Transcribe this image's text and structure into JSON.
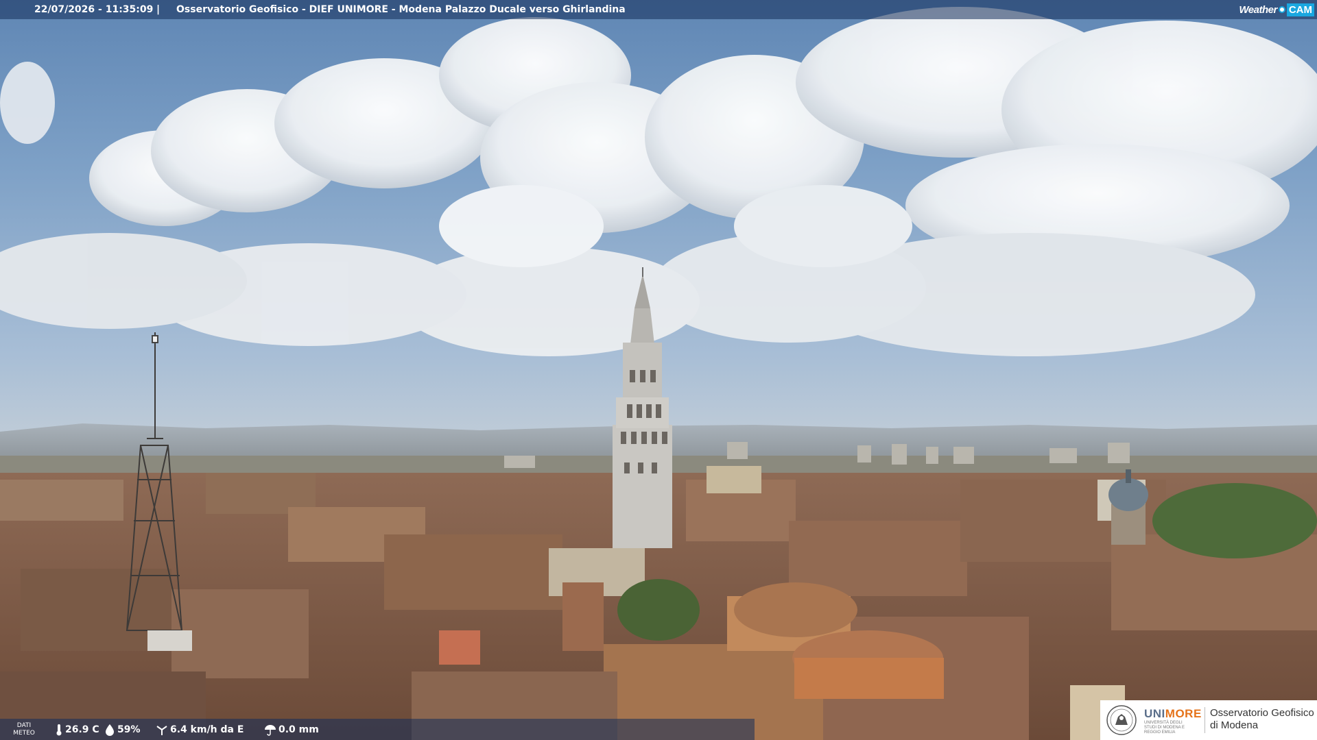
{
  "banner": {
    "datetime": "22/07/2026 - 11:35:09",
    "separator": "|",
    "title": "Osservatorio Geofisico - DIEF UNIMORE - Modena Palazzo Ducale verso Ghirlandina",
    "logo_weather": "Weather",
    "logo_cam": "CAM"
  },
  "weather_bar": {
    "label_line1": "DATI",
    "label_line2": "METEO",
    "temperature": "26.9 C",
    "temperature_icon": "thermometer-icon",
    "humidity": "59%",
    "humidity_icon": "droplet-icon",
    "wind": "6.4 km/h da E",
    "wind_icon": "wind-icon",
    "rain": "0.0 mm",
    "rain_icon": "umbrella-icon"
  },
  "unimore_logo": {
    "name_prefix": "UNI",
    "name_suffix": "MORE",
    "subtitle": "UNIVERSITÀ DEGLI STUDI DI MODENA E REGGIO EMILIA",
    "observatory_line1": "Osservatorio Geofisico",
    "observatory_line2": "di Modena"
  },
  "colors": {
    "banner_bg": "#142d5a",
    "cam_accent": "#1aa7e0",
    "unimore_orange": "#e5731a",
    "unimore_blue": "#5a6e8a"
  }
}
